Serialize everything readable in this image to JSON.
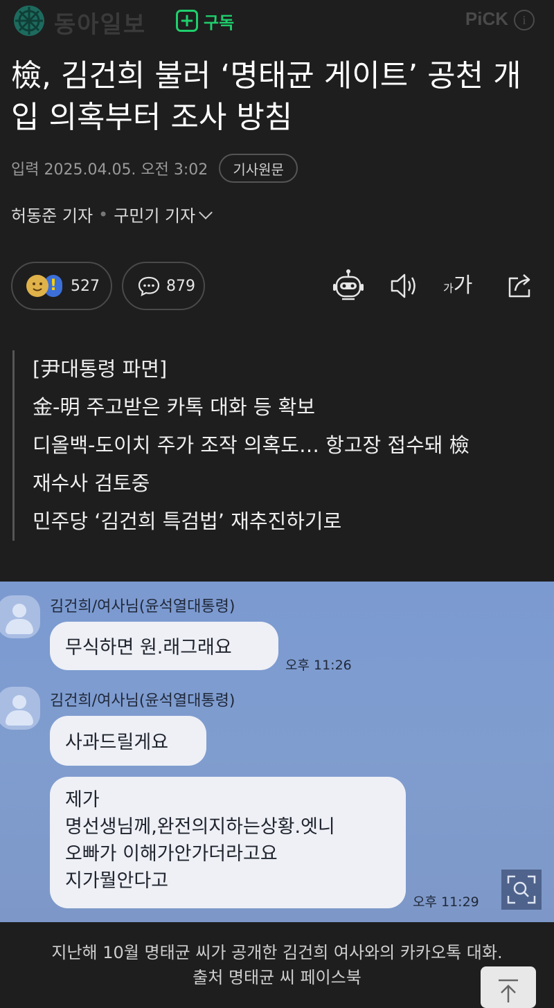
{
  "header": {
    "press_name": "동아일보",
    "subscribe_label": "구독",
    "pick_label": "PiCK",
    "info_icon": "i"
  },
  "article": {
    "title": "檢, 김건희 불러 ‘명태균 게이트’ 공천 개입 의혹부터 조사 방침",
    "date": "입력 2025.04.05. 오전 3:02",
    "original_link_label": "기사원문",
    "reporters": [
      "허동준 기자",
      "구민기 기자"
    ],
    "reporter_separator": "•",
    "reaction_count": "527",
    "comment_count": "879",
    "font_label_small": "가",
    "font_label_large": "가",
    "summary": [
      "[尹대통령 파면]",
      "金-明 주고받은 카톡 대화 등 확보",
      "디올백-도이치 주가 조작 의혹도… 항고장 접수돼 檢",
      "재수사 검토중",
      "민주당 ‘김건희 특검법’ 재추진하기로"
    ]
  },
  "photo": {
    "messages": [
      {
        "sender": "김건희/여사님(윤석열대통령)",
        "text": "무식하면 원.래그래요",
        "time": "오후 11:26"
      },
      {
        "sender": "김건희/여사님(윤석열대통령)",
        "text": "사과드릴게요",
        "time": ""
      },
      {
        "sender": "",
        "text_lines": [
          "제가",
          "명선생님께,완전의지하는상황.엣니",
          "오빠가 이해가안가더라고요",
          "지가뭘안다고"
        ],
        "time": "오후 11:29"
      }
    ],
    "caption_lines": [
      "지난해 10월 명태균 씨가 공개한 김건희 여사와의 카카오톡 대화.",
      "출처 명태균 씨 페이스북"
    ]
  },
  "colors": {
    "background": "#1e1e1e",
    "accent_green": "#1fcf6c",
    "photo_blue": "#7f9ccf"
  },
  "icons": [
    "press-logo-icon",
    "plus-icon",
    "info-icon",
    "chevron-down-icon",
    "emoji-smile-icon",
    "emoji-exclaim-icon",
    "comment-icon",
    "robot-icon",
    "speaker-icon",
    "share-icon",
    "zoom-icon",
    "arrow-up-icon"
  ]
}
